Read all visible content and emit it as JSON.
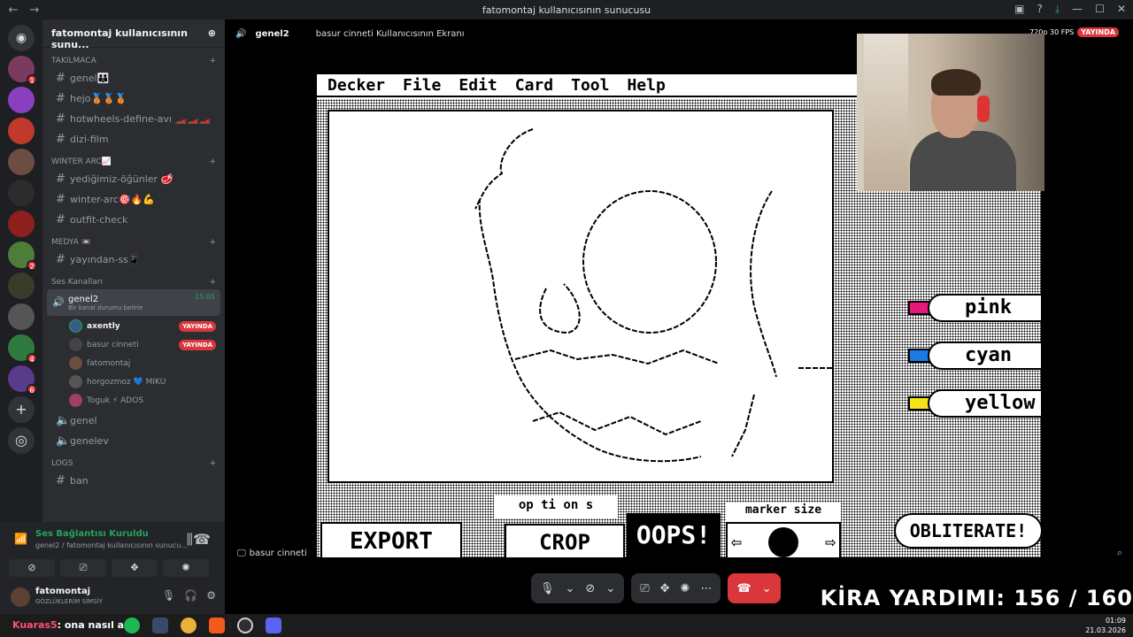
{
  "window": {
    "title": "fatomontaj kullanıcısının sunucusu"
  },
  "server": {
    "name": "fatomontaj kullanıcısının sunu..."
  },
  "guild_badges": [
    "1",
    "2",
    "4",
    "6"
  ],
  "categories": {
    "takilmaca": "TAKILMACA",
    "winter": "WINTER ARC📈",
    "medya": "MEDYA 📼",
    "ses": "Ses Kanalları",
    "logs": "LOGS"
  },
  "channels": {
    "genel": "genel👨‍👨‍👦",
    "hejo": "hejo🥉🥉🥉",
    "hotwheels": "hotwheels-define-avı 🏎️🏎️🏎️",
    "dizi": "dizi-film",
    "yedigimiz": "yediğimiz-öğünler 🥩",
    "winterarc": "winter-arc🎯🔥💪",
    "outfit": "outfit-check",
    "yayindan": "yayından-ss📱",
    "ban": "ban"
  },
  "voice": {
    "active_channel": "genel2",
    "active_time": "15:05",
    "active_status": "Bir kanal durumu belirle",
    "members": [
      {
        "name": "axently",
        "live": "YAYINDA",
        "speaking": true
      },
      {
        "name": "basur cinneti",
        "live": "YAYINDA",
        "speaking": false
      },
      {
        "name": "fatomontaj",
        "live": "",
        "speaking": false
      },
      {
        "name": "horgozmoz 💙 MIKU",
        "live": "",
        "speaking": false
      },
      {
        "name": "Toguk ⚡ ADOS",
        "live": "",
        "speaking": false
      }
    ],
    "other_channels": [
      "genel",
      "genelev"
    ]
  },
  "connection": {
    "status": "Ses Bağlantısı Kuruldu",
    "detail": "genel2 / fatomontaj kullanıcısının sunucu..."
  },
  "user": {
    "name": "fatomontaj",
    "status": "GÖZLÜKLERİM SİMSİY"
  },
  "stage": {
    "channel": "genel2",
    "screen_title": "basur cinneti Kullanıcısının Ekranı",
    "quality": "720p 30 FPS",
    "live": "YAYINDA",
    "streamer": "basur cinneti"
  },
  "decker": {
    "menu": [
      "Decker",
      "File",
      "Edit",
      "Card",
      "Tool",
      "Help"
    ],
    "buttons": {
      "export": "EXPORT",
      "options": "op ti on s",
      "crop": "CROP",
      "oops": "OOPS!",
      "marker_size": "marker size",
      "obliterate": "OBLITERATE!"
    },
    "markers": [
      {
        "label": "pink",
        "color": "#e6197a"
      },
      {
        "label": "cyan",
        "color": "#1a7be6"
      },
      {
        "label": "yellow",
        "color": "#f5e21a"
      }
    ]
  },
  "overlay": {
    "kira": "KİRA YARDIMI:  156 / 160"
  },
  "taskbar": {
    "ticker_nick": "Kuaras5",
    "ticker_text": ": ona nasıl aq",
    "time": "01:09",
    "date": "21.03.2026"
  },
  "colors": {
    "accent_live": "#da373c",
    "voice_green": "#23a55a",
    "blurple": "#5865f2"
  }
}
